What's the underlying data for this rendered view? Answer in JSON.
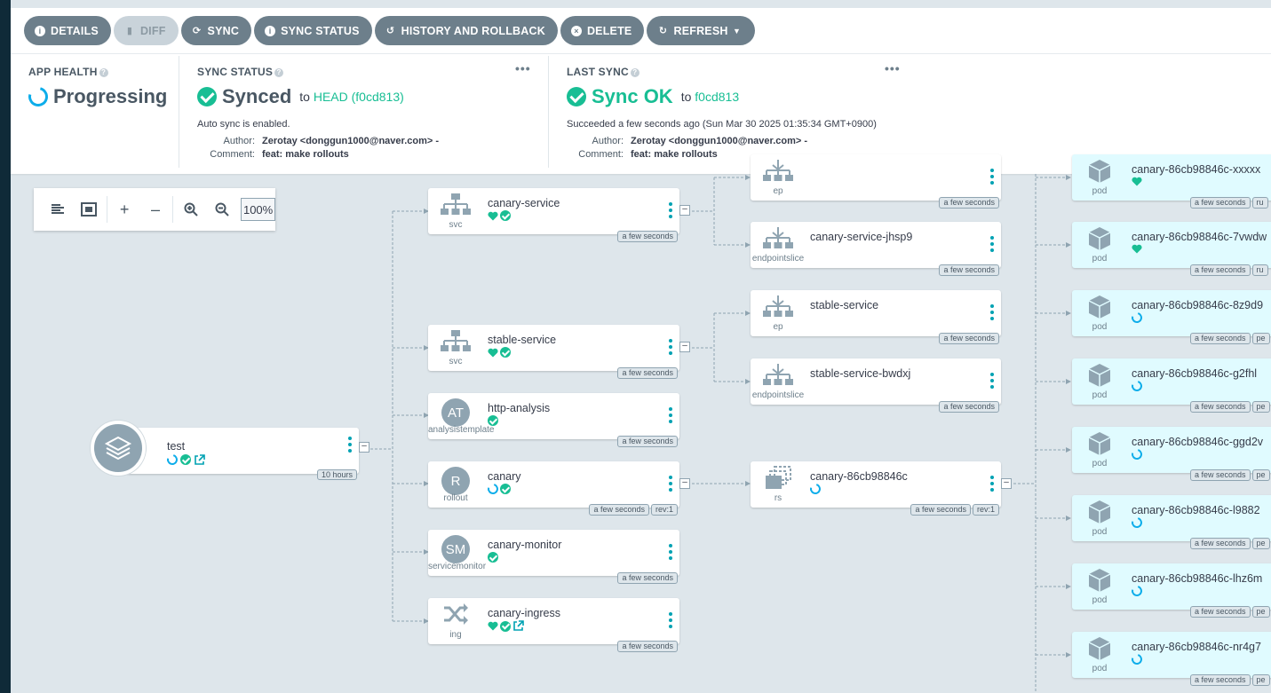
{
  "toolbar": {
    "details": "DETAILS",
    "diff": "DIFF",
    "sync": "SYNC",
    "sync_status": "SYNC STATUS",
    "history": "HISTORY AND ROLLBACK",
    "delete": "DELETE",
    "refresh": "REFRESH"
  },
  "app_health": {
    "label": "APP HEALTH",
    "value": "Progressing"
  },
  "sync_status": {
    "label": "SYNC STATUS",
    "value": "Synced",
    "to": "to",
    "target": "HEAD (f0cd813)",
    "note": "Auto sync is enabled.",
    "author_label": "Author:",
    "author": "Zerotay <donggun1000@naver.com> -",
    "comment_label": "Comment:",
    "comment": "feat: make rollouts"
  },
  "last_sync": {
    "label": "LAST SYNC",
    "value": "Sync OK",
    "to": "to",
    "target": "f0cd813",
    "note": "Succeeded a few seconds ago (Sun Mar 30 2025 01:35:34 GMT+0900)",
    "author_label": "Author:",
    "author": "Zerotay <donggun1000@naver.com> -",
    "comment_label": "Comment:",
    "comment": "feat: make rollouts"
  },
  "graph_toolbar": {
    "zoom": "100%"
  },
  "root": {
    "name": "test",
    "age": "10 hours"
  },
  "colors": {
    "healthy": "#18be94",
    "progressing": "#0dadea",
    "accent": "#00a2b3",
    "button": "#6d7f8b"
  },
  "nodes": {
    "canary_service": {
      "name": "canary-service",
      "kind": "svc",
      "age": "a few seconds"
    },
    "stable_service": {
      "name": "stable-service",
      "kind": "svc",
      "age": "a few seconds"
    },
    "http_analysis": {
      "name": "http-analysis",
      "kind": "analysistemplate",
      "badge": "AT",
      "age": "a few seconds"
    },
    "canary": {
      "name": "canary",
      "kind": "rollout",
      "badge": "R",
      "age": "a few seconds",
      "rev": "rev:1"
    },
    "canary_monitor": {
      "name": "canary-monitor",
      "kind": "servicemonitor",
      "badge": "SM",
      "age": "a few seconds"
    },
    "canary_ingress": {
      "name": "canary-ingress",
      "kind": "ing",
      "age": "a few seconds"
    },
    "ep_top": {
      "name": "canary-service",
      "kind": "ep",
      "age": "a few seconds"
    },
    "eps_canary": {
      "name": "canary-service-jhsp9",
      "kind": "endpointslice",
      "age": "a few seconds"
    },
    "ep_stable": {
      "name": "stable-service",
      "kind": "ep",
      "age": "a few seconds"
    },
    "eps_stable": {
      "name": "stable-service-bwdxj",
      "kind": "endpointslice",
      "age": "a few seconds"
    },
    "rs": {
      "name": "canary-86cb98846c",
      "kind": "rs",
      "age": "a few seconds",
      "rev": "rev:1"
    }
  },
  "pods": [
    {
      "name": "canary-86cb98846c-xxxxx",
      "kind": "pod",
      "age": "a few seconds",
      "state": "ru"
    },
    {
      "name": "canary-86cb98846c-7vwdw",
      "kind": "pod",
      "age": "a few seconds",
      "state": "ru"
    },
    {
      "name": "canary-86cb98846c-8z9d9",
      "kind": "pod",
      "age": "a few seconds",
      "state": "pe"
    },
    {
      "name": "canary-86cb98846c-g2fhl",
      "kind": "pod",
      "age": "a few seconds",
      "state": "pe"
    },
    {
      "name": "canary-86cb98846c-ggd2v",
      "kind": "pod",
      "age": "a few seconds",
      "state": "pe"
    },
    {
      "name": "canary-86cb98846c-l9882",
      "kind": "pod",
      "age": "a few seconds",
      "state": "pe"
    },
    {
      "name": "canary-86cb98846c-lhz6m",
      "kind": "pod",
      "age": "a few seconds",
      "state": "pe"
    },
    {
      "name": "canary-86cb98846c-nr4g7",
      "kind": "pod",
      "age": "a few seconds",
      "state": "pe"
    }
  ]
}
